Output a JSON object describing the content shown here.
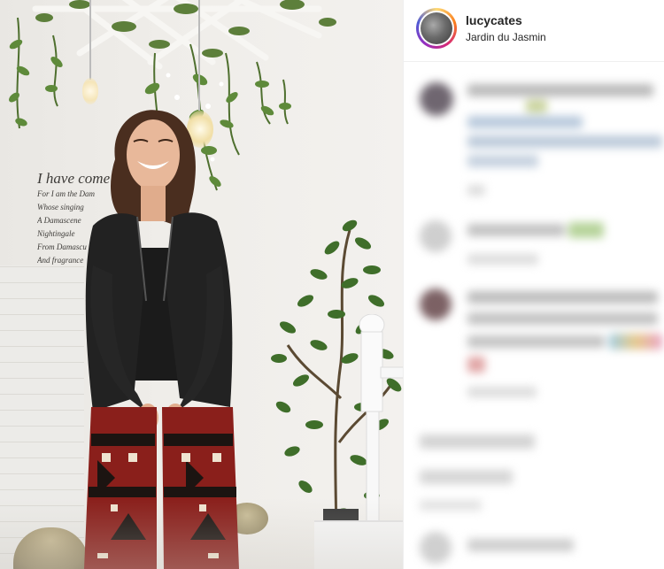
{
  "post": {
    "username": "lucycates",
    "location": "Jardin du Jasmin"
  },
  "wall_text": {
    "heading": "I have come",
    "lines": [
      "For I am the Dam",
      "Whose singing",
      "A Damascene",
      "Nightingale",
      "From Damascu",
      "And fragrance"
    ]
  },
  "colors": {
    "avatar_ring": [
      "#feda75",
      "#fa7e1e",
      "#d62976",
      "#962fbf",
      "#4f5bd5"
    ],
    "text_primary": "#262626",
    "divider": "#efefef"
  },
  "icons": [
    "profile-avatar"
  ]
}
